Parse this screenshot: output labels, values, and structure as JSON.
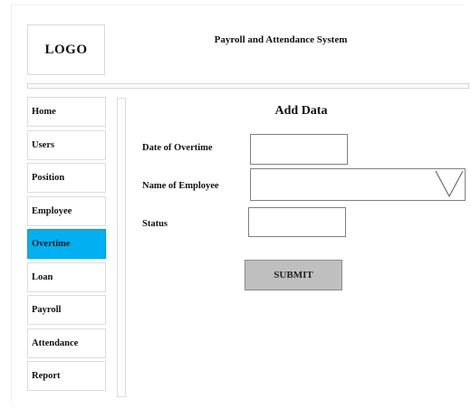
{
  "header": {
    "logo_text": "LOGO",
    "app_title": "Payroll and Attendance System"
  },
  "sidebar": {
    "items": [
      {
        "label": "Home",
        "active": false
      },
      {
        "label": "Users",
        "active": false
      },
      {
        "label": "Position",
        "active": false
      },
      {
        "label": "Employee",
        "active": false
      },
      {
        "label": "Overtime",
        "active": true
      },
      {
        "label": "Loan",
        "active": false
      },
      {
        "label": "Payroll",
        "active": false
      },
      {
        "label": "Attendance",
        "active": false
      },
      {
        "label": "Report",
        "active": false
      }
    ],
    "active_color": "#00b0f0"
  },
  "form": {
    "title": "Add Data",
    "date_of_overtime": {
      "label": "Date of Overtime",
      "value": ""
    },
    "name_of_employee": {
      "label": "Name of Employee",
      "value": "",
      "icon": "chevron-down-icon"
    },
    "status": {
      "label": "Status",
      "value": ""
    },
    "submit_label": "SUBMIT"
  },
  "colors": {
    "button_bg": "#bfbfbf",
    "border": "#7f7f7f"
  }
}
